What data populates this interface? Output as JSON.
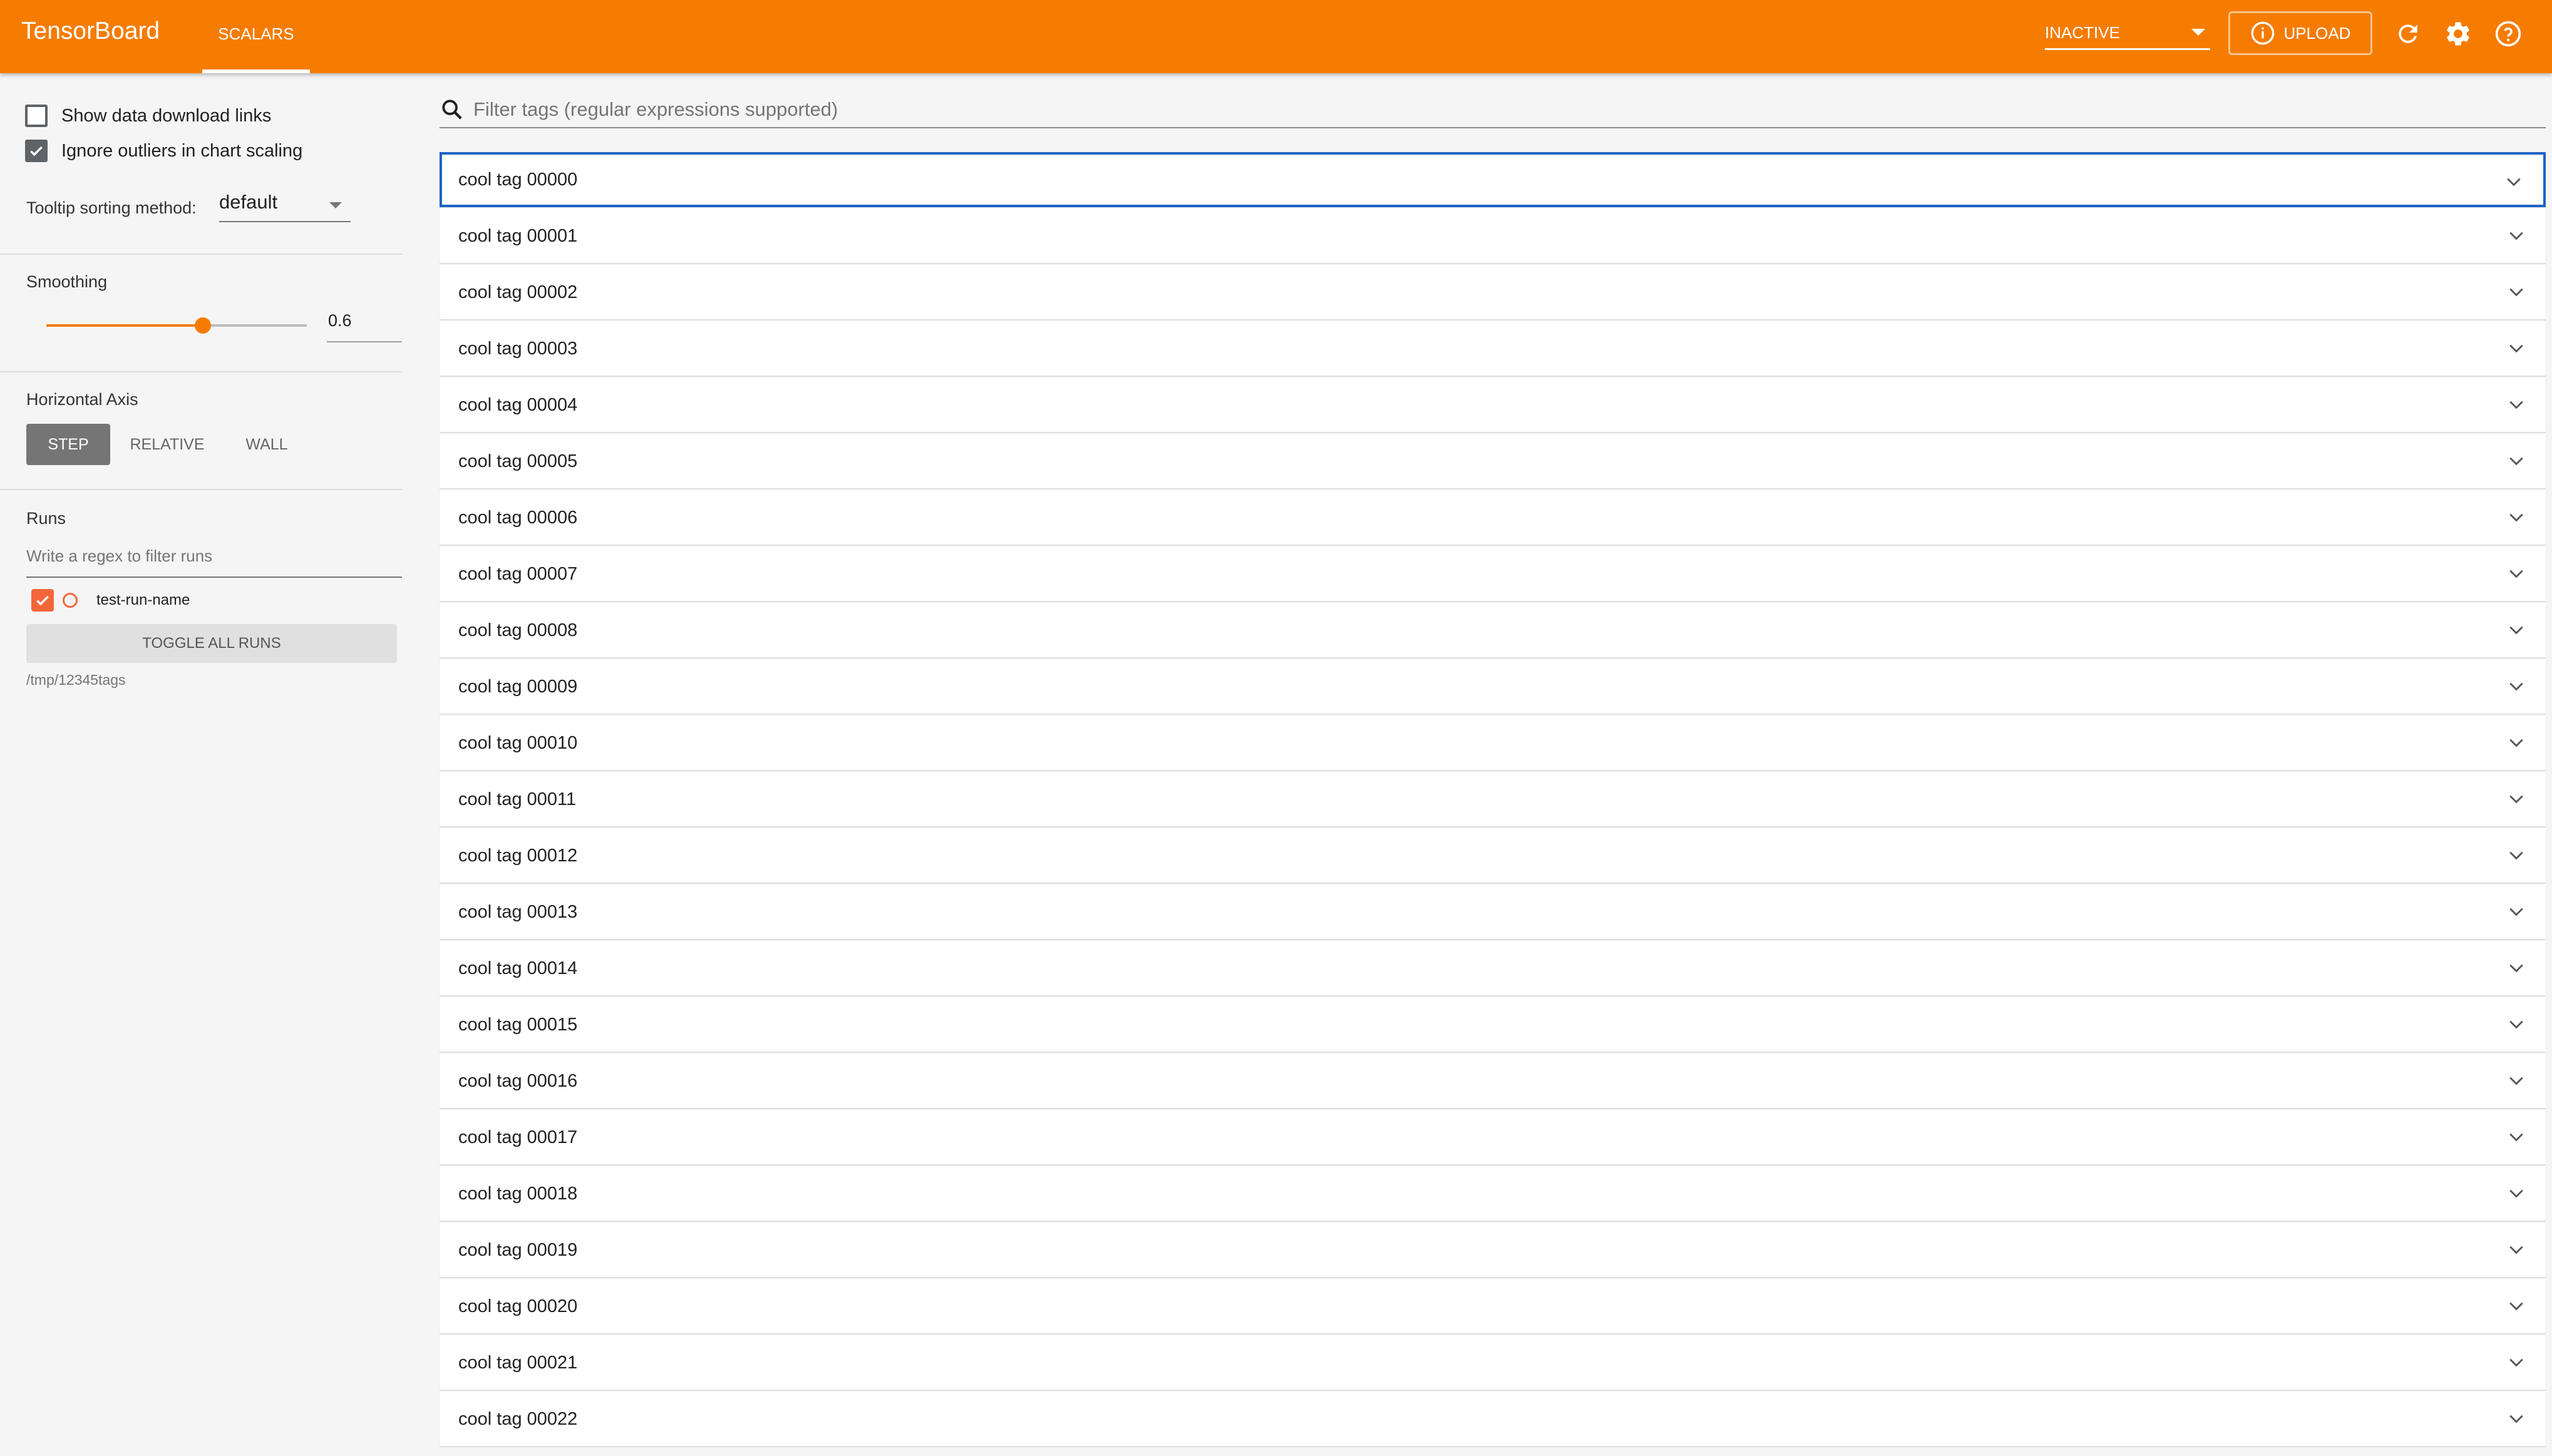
{
  "header": {
    "brand": "TensorBoard",
    "tabs": [
      {
        "label": "SCALARS",
        "active": true
      }
    ],
    "status_select": "INACTIVE",
    "upload_label": "UPLOAD",
    "icons": [
      "refresh-icon",
      "settings-icon",
      "help-icon"
    ],
    "accent_color": "#f57c00"
  },
  "sidebar": {
    "show_download_label": "Show data download links",
    "show_download_checked": false,
    "ignore_outliers_label": "Ignore outliers in chart scaling",
    "ignore_outliers_checked": true,
    "tooltip_label": "Tooltip sorting method:",
    "tooltip_value": "default",
    "smoothing_label": "Smoothing",
    "smoothing_value": "0.6",
    "smoothing_fraction": 0.6,
    "horizontal_axis_label": "Horizontal Axis",
    "axis_options": [
      "STEP",
      "RELATIVE",
      "WALL"
    ],
    "axis_selected": "STEP",
    "runs_label": "Runs",
    "runs_filter_placeholder": "Write a regex to filter runs",
    "runs": [
      {
        "name": "test-run-name",
        "checked": true,
        "color": "#f4663a"
      }
    ],
    "toggle_all_label": "TOGGLE ALL RUNS",
    "logdir": "/tmp/12345tags"
  },
  "main": {
    "filter_placeholder": "Filter tags (regular expressions supported)",
    "tags": [
      "cool tag 00000",
      "cool tag 00001",
      "cool tag 00002",
      "cool tag 00003",
      "cool tag 00004",
      "cool tag 00005",
      "cool tag 00006",
      "cool tag 00007",
      "cool tag 00008",
      "cool tag 00009",
      "cool tag 00010",
      "cool tag 00011",
      "cool tag 00012",
      "cool tag 00013",
      "cool tag 00014",
      "cool tag 00015",
      "cool tag 00016",
      "cool tag 00017",
      "cool tag 00018",
      "cool tag 00019",
      "cool tag 00020",
      "cool tag 00021",
      "cool tag 00022"
    ],
    "focused_index": 0
  }
}
